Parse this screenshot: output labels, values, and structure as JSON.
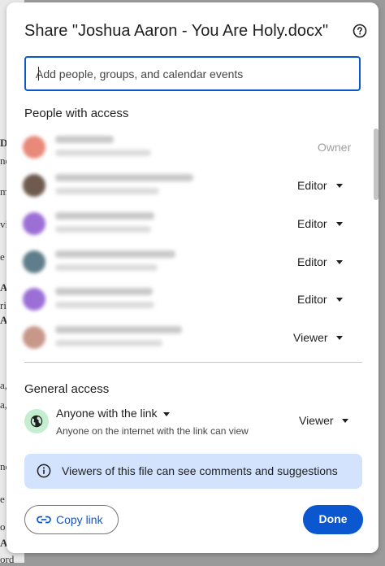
{
  "dialog": {
    "title": "Share \"Joshua Aaron - You Are Holy.docx\"",
    "help_icon": "help-circle-icon",
    "search": {
      "placeholder": "Add people, groups, and calendar events",
      "value": ""
    },
    "people_section_title": "People with access",
    "people": [
      {
        "role": "Owner",
        "avatar_color": "#e8897a",
        "has_dropdown": false
      },
      {
        "role": "Editor",
        "avatar_color": "#6e5a4e",
        "has_dropdown": true
      },
      {
        "role": "Editor",
        "avatar_color": "#9c6fd6",
        "has_dropdown": true
      },
      {
        "role": "Editor",
        "avatar_color": "#5f7d8a",
        "has_dropdown": true
      },
      {
        "role": "Editor",
        "avatar_color": "#9c6fd6",
        "has_dropdown": true
      },
      {
        "role": "Viewer",
        "avatar_color": "#c7978a",
        "has_dropdown": true
      }
    ],
    "general_access": {
      "title": "General access",
      "link_setting": "Anyone with the link",
      "link_description": "Anyone on the internet with the link can view",
      "role": "Viewer",
      "icon": "globe-icon"
    },
    "info_banner": {
      "icon": "info-icon",
      "text": "Viewers of this file can see comments and suggestions"
    },
    "copy_link": {
      "label": "Copy link",
      "icon": "link-icon"
    },
    "done": {
      "label": "Done"
    }
  },
  "background_fragments": [
    "D",
    "nc",
    "m",
    "vi",
    "e",
    "A",
    "ri",
    "A",
    "a,",
    "a,",
    "nc",
    "e",
    "o",
    "A",
    "ord"
  ],
  "colors": {
    "accent": "#0b57d0",
    "banner": "#d3e3fd",
    "globe_bg": "#c4eed0"
  }
}
